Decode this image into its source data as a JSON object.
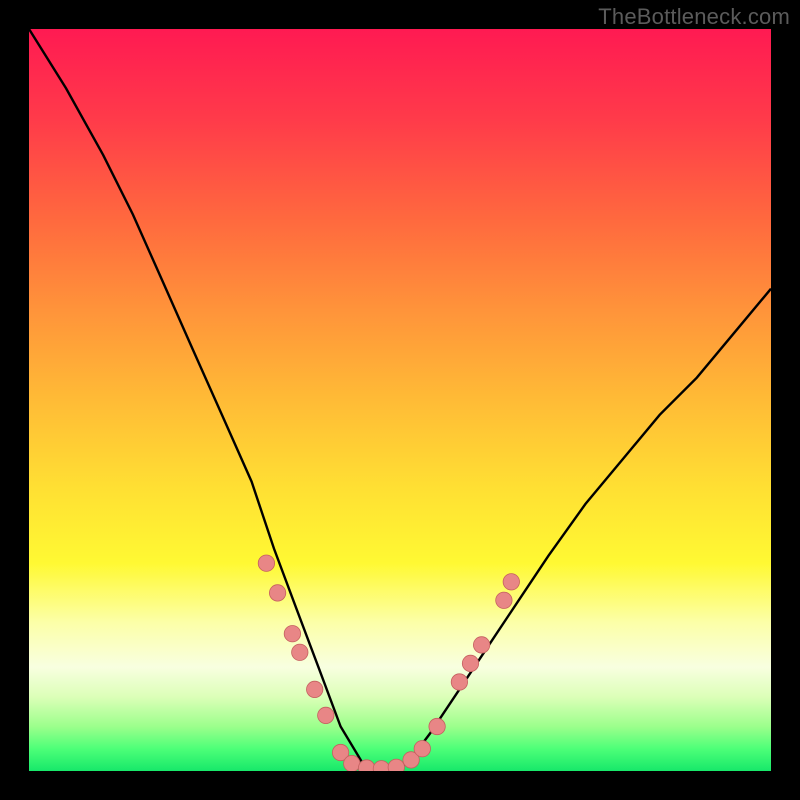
{
  "watermark": {
    "text": "TheBottleneck.com"
  },
  "colors": {
    "curve": "#000000",
    "dot_fill": "#e88686",
    "dot_stroke": "#c55f5f"
  },
  "chart_data": {
    "type": "line",
    "title": "",
    "xlabel": "",
    "ylabel": "",
    "xlim": [
      0,
      100
    ],
    "ylim": [
      0,
      100
    ],
    "grid": false,
    "legend": false,
    "note": "V-shaped bottleneck curve; minimum (~0) between x≈42 and x≈52; left branch rises steeply toward 100 at x≈0; right branch rises toward ~65 near x≈100.",
    "series": [
      {
        "name": "curve",
        "x": [
          0,
          5,
          10,
          14,
          18,
          22,
          26,
          30,
          33,
          36,
          39,
          42,
          45,
          48,
          51,
          54,
          58,
          62,
          66,
          70,
          75,
          80,
          85,
          90,
          95,
          100
        ],
        "y": [
          100,
          92,
          83,
          75,
          66,
          57,
          48,
          39,
          30,
          22,
          14,
          6,
          1,
          0,
          1,
          5,
          11,
          17,
          23,
          29,
          36,
          42,
          48,
          53,
          59,
          65
        ]
      }
    ],
    "markers": {
      "name": "dots",
      "note": "Pink circular markers clustered around the trough of the V.",
      "points": [
        {
          "x": 32.0,
          "y": 28.0,
          "r": 1.1
        },
        {
          "x": 33.5,
          "y": 24.0,
          "r": 1.1
        },
        {
          "x": 35.5,
          "y": 18.5,
          "r": 1.1
        },
        {
          "x": 36.5,
          "y": 16.0,
          "r": 1.1
        },
        {
          "x": 38.5,
          "y": 11.0,
          "r": 1.1
        },
        {
          "x": 40.0,
          "y": 7.5,
          "r": 1.1
        },
        {
          "x": 42.0,
          "y": 2.5,
          "r": 1.1
        },
        {
          "x": 43.5,
          "y": 1.0,
          "r": 1.1
        },
        {
          "x": 45.5,
          "y": 0.4,
          "r": 1.1
        },
        {
          "x": 47.5,
          "y": 0.3,
          "r": 1.1
        },
        {
          "x": 49.5,
          "y": 0.5,
          "r": 1.1
        },
        {
          "x": 51.5,
          "y": 1.5,
          "r": 1.1
        },
        {
          "x": 53.0,
          "y": 3.0,
          "r": 1.1
        },
        {
          "x": 55.0,
          "y": 6.0,
          "r": 1.1
        },
        {
          "x": 58.0,
          "y": 12.0,
          "r": 1.1
        },
        {
          "x": 59.5,
          "y": 14.5,
          "r": 1.1
        },
        {
          "x": 61.0,
          "y": 17.0,
          "r": 1.1
        },
        {
          "x": 64.0,
          "y": 23.0,
          "r": 1.1
        },
        {
          "x": 65.0,
          "y": 25.5,
          "r": 1.1
        }
      ]
    }
  }
}
